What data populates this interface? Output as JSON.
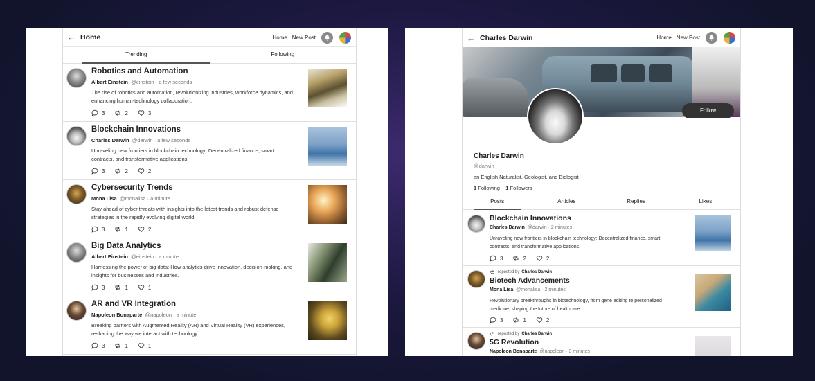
{
  "left": {
    "header": {
      "back": "←",
      "title": "Home",
      "nav_home": "Home",
      "nav_new_post": "New Post"
    },
    "tabs": [
      "Trending",
      "Following"
    ],
    "posts": [
      {
        "title": "Robotics and Automation",
        "author": "Albert Einstein",
        "handle": "@einstein",
        "time": "· a few seconds",
        "body": "The rise of robotics and automation, revolutionizing industries, workforce dynamics, and enhancing human-technology collaboration.",
        "comments": "3",
        "reposts": "2",
        "likes": "3"
      },
      {
        "title": "Blockchain Innovations",
        "author": "Charles Darwin",
        "handle": "@darwin",
        "time": "· a few seconds",
        "body": "Unraveling new frontiers in blockchain technology: Decentralized finance, smart contracts, and transformative applications.",
        "comments": "3",
        "reposts": "2",
        "likes": "2"
      },
      {
        "title": "Cybersecurity Trends",
        "author": "Mona Lisa",
        "handle": "@monalisa",
        "time": "· a minute",
        "body": "Stay ahead of cyber threats with insights into the latest trends and robust defense strategies in the rapidly evolving digital world.",
        "comments": "3",
        "reposts": "1",
        "likes": "2"
      },
      {
        "title": "Big Data Analytics",
        "author": "Albert Einstein",
        "handle": "@einstein",
        "time": "· a minute",
        "body": "Harnessing the power of big data: How analytics drive innovation, decision-making, and insights for businesses and industries.",
        "comments": "3",
        "reposts": "1",
        "likes": "1"
      },
      {
        "title": "AR and VR Integration",
        "author": "Napoleon Bonaparte",
        "handle": "@napoleon",
        "time": "· a minute",
        "body": "Breaking barriers with Augmented Reality (AR) and Virtual Reality (VR) experiences, reshaping the way we interact with technology.",
        "comments": "3",
        "reposts": "1",
        "likes": "1"
      }
    ]
  },
  "right": {
    "header": {
      "back": "←",
      "title": "Charles Darwin",
      "nav_home": "Home",
      "nav_new_post": "New Post"
    },
    "profile": {
      "name": "Charles Darwin",
      "handle": "@darwin",
      "bio": "an English Naturalist, Geologist, and Biologist",
      "following_count": "1",
      "following_label": "Following",
      "followers_count": "1",
      "followers_label": "Followers",
      "follow_button": "Follow"
    },
    "tabs": [
      "Posts",
      "Articles",
      "Replies",
      "Likes"
    ],
    "posts": [
      {
        "title": "Blockchain Innovations",
        "author": "Charles Darwin",
        "handle": "@darwin",
        "time": "· 2 minutes",
        "body": "Unraveling new frontiers in blockchain technology: Decentralized finance, smart contracts, and transformative applications.",
        "comments": "3",
        "reposts": "2",
        "likes": "2"
      },
      {
        "reposted_by_label": "reposted by",
        "reposted_by": "Charles Darwin",
        "title": "Biotech Advancements",
        "author": "Mona Lisa",
        "handle": "@monalisa",
        "time": "· 2 minutes",
        "body": "Revolutionary breakthroughs in biotechnology, from gene editing to personalized medicine, shaping the future of healthcare.",
        "comments": "3",
        "reposts": "1",
        "likes": "2"
      },
      {
        "reposted_by_label": "reposted by",
        "reposted_by": "Charles Darwin",
        "title": "5G Revolution",
        "author": "Napoleon Bonaparte",
        "handle": "@napoleon",
        "time": "· 3 minutes"
      }
    ]
  }
}
